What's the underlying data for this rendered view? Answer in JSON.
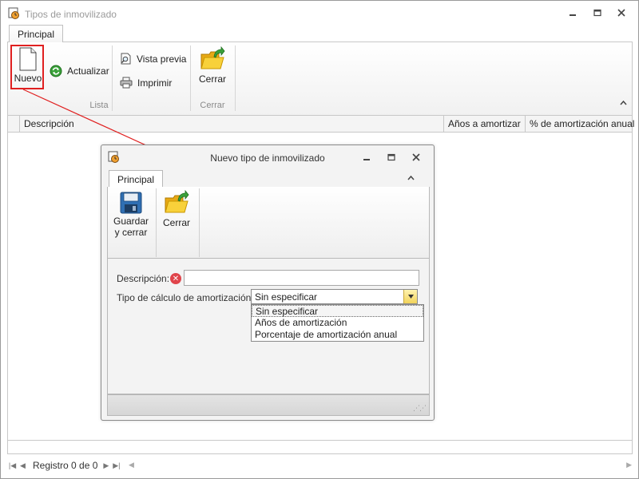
{
  "main_window": {
    "title": "Tipos de inmovilizado",
    "tab": "Principal",
    "ribbon": {
      "groups": {
        "lista": "Lista",
        "cerrar": "Cerrar"
      },
      "buttons": {
        "nuevo": "Nuevo",
        "actualizar": "Actualizar",
        "vista_previa": "Vista previa",
        "imprimir": "Imprimir",
        "cerrar": "Cerrar"
      }
    },
    "grid": {
      "columns": [
        "Descripción",
        "Años a amortizar",
        "% de amortización anual"
      ]
    },
    "navigator": {
      "record_text": "Registro 0 de 0"
    }
  },
  "dialog": {
    "title": "Nuevo tipo de inmovilizado",
    "tab": "Principal",
    "buttons": {
      "guardar_line1": "Guardar",
      "guardar_line2": "y cerrar",
      "cerrar": "Cerrar"
    },
    "form": {
      "descripcion_label": "Descripción:",
      "descripcion_value": "",
      "tipo_label": "Tipo de cálculo de amortización:",
      "tipo_value": "Sin especificar",
      "tipo_options": [
        "Sin especificar",
        "Años de amortización",
        "Porcentaje de amortización anual"
      ]
    }
  },
  "colors": {
    "highlight": "#e02020",
    "error": "#e0444b",
    "folder": "#f2c12e",
    "arrow_green": "#3aa13a"
  }
}
